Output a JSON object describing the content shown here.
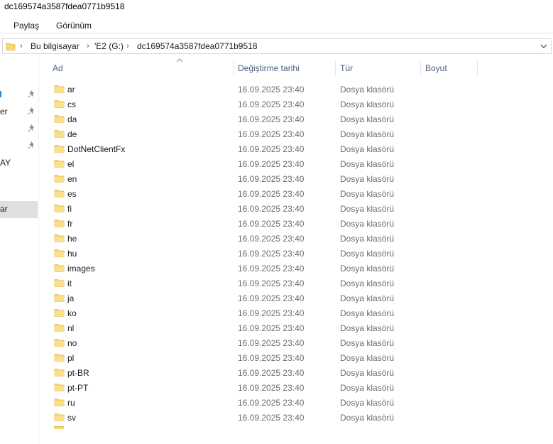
{
  "window": {
    "title": "dc169574a3587fdea0771b9518"
  },
  "ribbon": {
    "tabs": [
      "Paylaş",
      "Görünüm"
    ]
  },
  "address": {
    "segments": [
      "Bu bilgisayar",
      "'E2 (G:)",
      "dc169574a3587fdea0771b9518"
    ],
    "separator": "›"
  },
  "nav": {
    "items": [
      {
        "label": "",
        "pinned": true,
        "accent": true
      },
      {
        "label": "er",
        "pinned": true
      },
      {
        "label": "",
        "pinned": true
      },
      {
        "label": "",
        "pinned": true
      },
      {
        "label": "AY",
        "pinned": false
      },
      {
        "label": "ar",
        "pinned": false,
        "selected": true
      }
    ]
  },
  "columns": {
    "name": "Ad",
    "modified": "Değiştirme tarihi",
    "type": "Tür",
    "size": "Boyut",
    "sorted_by": "name"
  },
  "files": [
    {
      "name": "ar",
      "date": "16.09.2025 23:40",
      "type": "Dosya klasörü"
    },
    {
      "name": "cs",
      "date": "16.09.2025 23:40",
      "type": "Dosya klasörü"
    },
    {
      "name": "da",
      "date": "16.09.2025 23:40",
      "type": "Dosya klasörü"
    },
    {
      "name": "de",
      "date": "16.09.2025 23:40",
      "type": "Dosya klasörü"
    },
    {
      "name": "DotNetClientFx",
      "date": "16.09.2025 23:40",
      "type": "Dosya klasörü"
    },
    {
      "name": "el",
      "date": "16.09.2025 23:40",
      "type": "Dosya klasörü"
    },
    {
      "name": "en",
      "date": "16.09.2025 23:40",
      "type": "Dosya klasörü"
    },
    {
      "name": "es",
      "date": "16.09.2025 23:40",
      "type": "Dosya klasörü"
    },
    {
      "name": "fi",
      "date": "16.09.2025 23:40",
      "type": "Dosya klasörü"
    },
    {
      "name": "fr",
      "date": "16.09.2025 23:40",
      "type": "Dosya klasörü"
    },
    {
      "name": "he",
      "date": "16.09.2025 23:40",
      "type": "Dosya klasörü"
    },
    {
      "name": "hu",
      "date": "16.09.2025 23:40",
      "type": "Dosya klasörü"
    },
    {
      "name": "images",
      "date": "16.09.2025 23:40",
      "type": "Dosya klasörü"
    },
    {
      "name": "it",
      "date": "16.09.2025 23:40",
      "type": "Dosya klasörü"
    },
    {
      "name": "ja",
      "date": "16.09.2025 23:40",
      "type": "Dosya klasörü"
    },
    {
      "name": "ko",
      "date": "16.09.2025 23:40",
      "type": "Dosya klasörü"
    },
    {
      "name": "nl",
      "date": "16.09.2025 23:40",
      "type": "Dosya klasörü"
    },
    {
      "name": "no",
      "date": "16.09.2025 23:40",
      "type": "Dosya klasörü"
    },
    {
      "name": "pl",
      "date": "16.09.2025 23:40",
      "type": "Dosya klasörü"
    },
    {
      "name": "pt-BR",
      "date": "16.09.2025 23:40",
      "type": "Dosya klasörü"
    },
    {
      "name": "pt-PT",
      "date": "16.09.2025 23:40",
      "type": "Dosya klasörü"
    },
    {
      "name": "ru",
      "date": "16.09.2025 23:40",
      "type": "Dosya klasörü"
    },
    {
      "name": "sv",
      "date": "16.09.2025 23:40",
      "type": "Dosya klasörü"
    }
  ],
  "icons": {
    "folder": "folder-icon",
    "pin": "pin-icon",
    "dropdown": "chevron-down-icon",
    "sort": "sort-ascending-icon"
  },
  "colors": {
    "folder_fill": "#f7d774",
    "folder_edge": "#e0b84c",
    "header_text": "#4d6082",
    "secondary_text": "#6d6d6d",
    "selection": "#e0e0e0",
    "accent": "#2b86d9"
  }
}
